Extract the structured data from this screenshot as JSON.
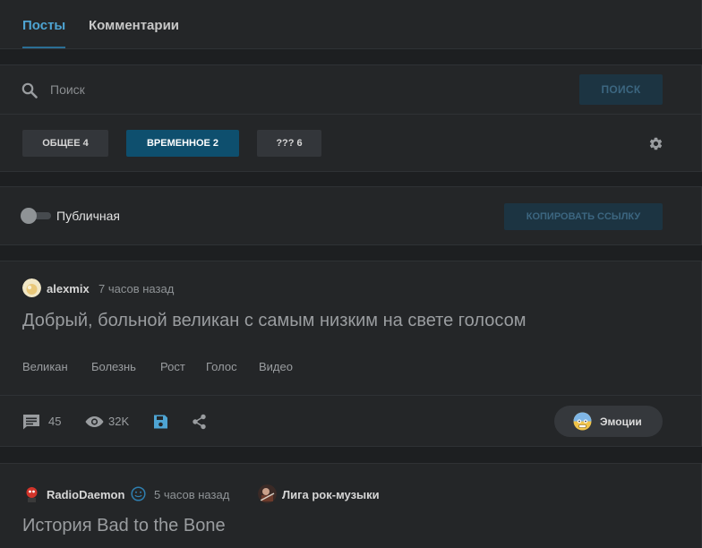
{
  "tabs": [
    {
      "label": "Посты",
      "active": true
    },
    {
      "label": "Комментарии",
      "active": false
    }
  ],
  "search": {
    "placeholder": "Поиск",
    "value": "",
    "button_label": "ПОИСК"
  },
  "filters": [
    {
      "label": "ОБЩЕЕ 4",
      "active": false
    },
    {
      "label": "ВРЕМЕННОЕ 2",
      "active": true
    },
    {
      "label": "??? 6",
      "active": false
    }
  ],
  "visibility": {
    "label": "Публичная",
    "enabled": false,
    "copy_button_label": "КОПИРОВАТЬ ССЫЛКУ"
  },
  "posts": [
    {
      "author": "alexmix",
      "time": "7 часов назад",
      "title": "Добрый, больной великан с самым низким на свете голосом",
      "tags": [
        "Великан",
        "Болезнь",
        "Рост",
        "Голос",
        "Видео"
      ],
      "comments": "45",
      "views": "32K",
      "emotions_label": "Эмоции"
    },
    {
      "author": "RadioDaemon",
      "time": "5 часов назад",
      "community": "Лига рок-музыки",
      "title": "История Bad to the Bone"
    }
  ],
  "colors": {
    "accent": "#4ea4d3",
    "active_filter": "#0e4f6e",
    "background": "#1d1f21",
    "card": "#242628"
  }
}
